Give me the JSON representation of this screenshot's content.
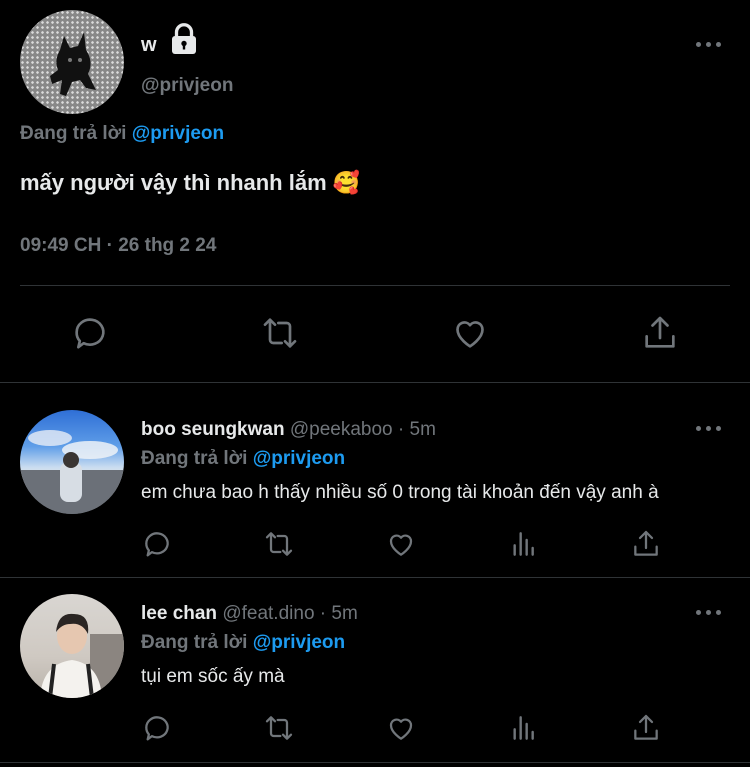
{
  "main_tweet": {
    "display_name": "w",
    "handle": "@privjeon",
    "replying_prefix": "Đang trả lời",
    "replying_to": "@privjeon",
    "text": "mấy người vậy thì nhanh lắm",
    "emoji": "🥰",
    "timestamp": "09:49 CH · 26 thg 2 24"
  },
  "replies": [
    {
      "display_name": "boo seungkwan",
      "handle": "@peekaboo",
      "time": "· 5m",
      "replying_prefix": "Đang trả lời",
      "replying_to": "@privjeon",
      "text": "em chưa bao h thấy nhiều số 0 trong tài khoản đến vậy anh à"
    },
    {
      "display_name": "lee chan",
      "handle": "@feat.dino",
      "time": "· 5m",
      "replying_prefix": "Đang trả lời",
      "replying_to": "@privjeon",
      "text": "tụi em sốc ấy mà"
    }
  ],
  "colors": {
    "background": "#000000",
    "text": "#e7e9ea",
    "muted": "#71767b",
    "accent": "#1d9bf0",
    "divider": "#2f3336"
  },
  "icons": [
    "lock-icon",
    "more-icon",
    "reply-icon",
    "retweet-icon",
    "like-icon",
    "views-icon",
    "share-icon"
  ]
}
